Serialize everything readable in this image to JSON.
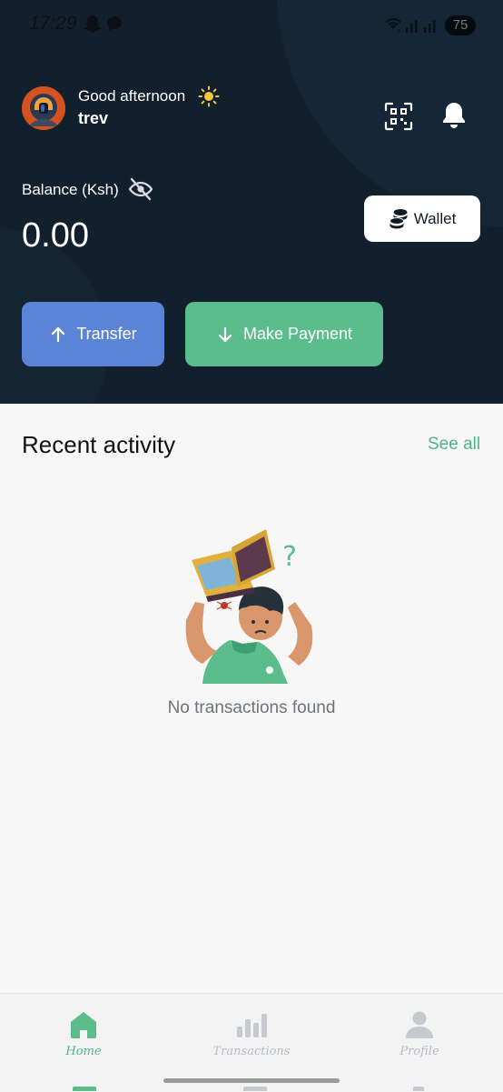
{
  "status_bar": {
    "time": "17:29",
    "battery": "75"
  },
  "header": {
    "greeting": "Good afternoon",
    "username": "trev",
    "balance_label": "Balance (Ksh)",
    "balance_value": "0.00",
    "wallet_label": "Wallet",
    "transfer_label": "Transfer",
    "payment_label": "Make Payment"
  },
  "activity": {
    "title": "Recent activity",
    "see_all": "See all",
    "empty_text": "No transactions found"
  },
  "nav": {
    "items": [
      {
        "label": "Home",
        "icon": "home-icon",
        "active": true
      },
      {
        "label": "Transactions",
        "icon": "bar-chart-icon",
        "active": false
      },
      {
        "label": "Profile",
        "icon": "person-icon",
        "active": false
      }
    ]
  },
  "colors": {
    "header_bg": "#12202d",
    "transfer": "#5b84d6",
    "payment": "#5bbd8c",
    "accent": "#4fb48a"
  }
}
